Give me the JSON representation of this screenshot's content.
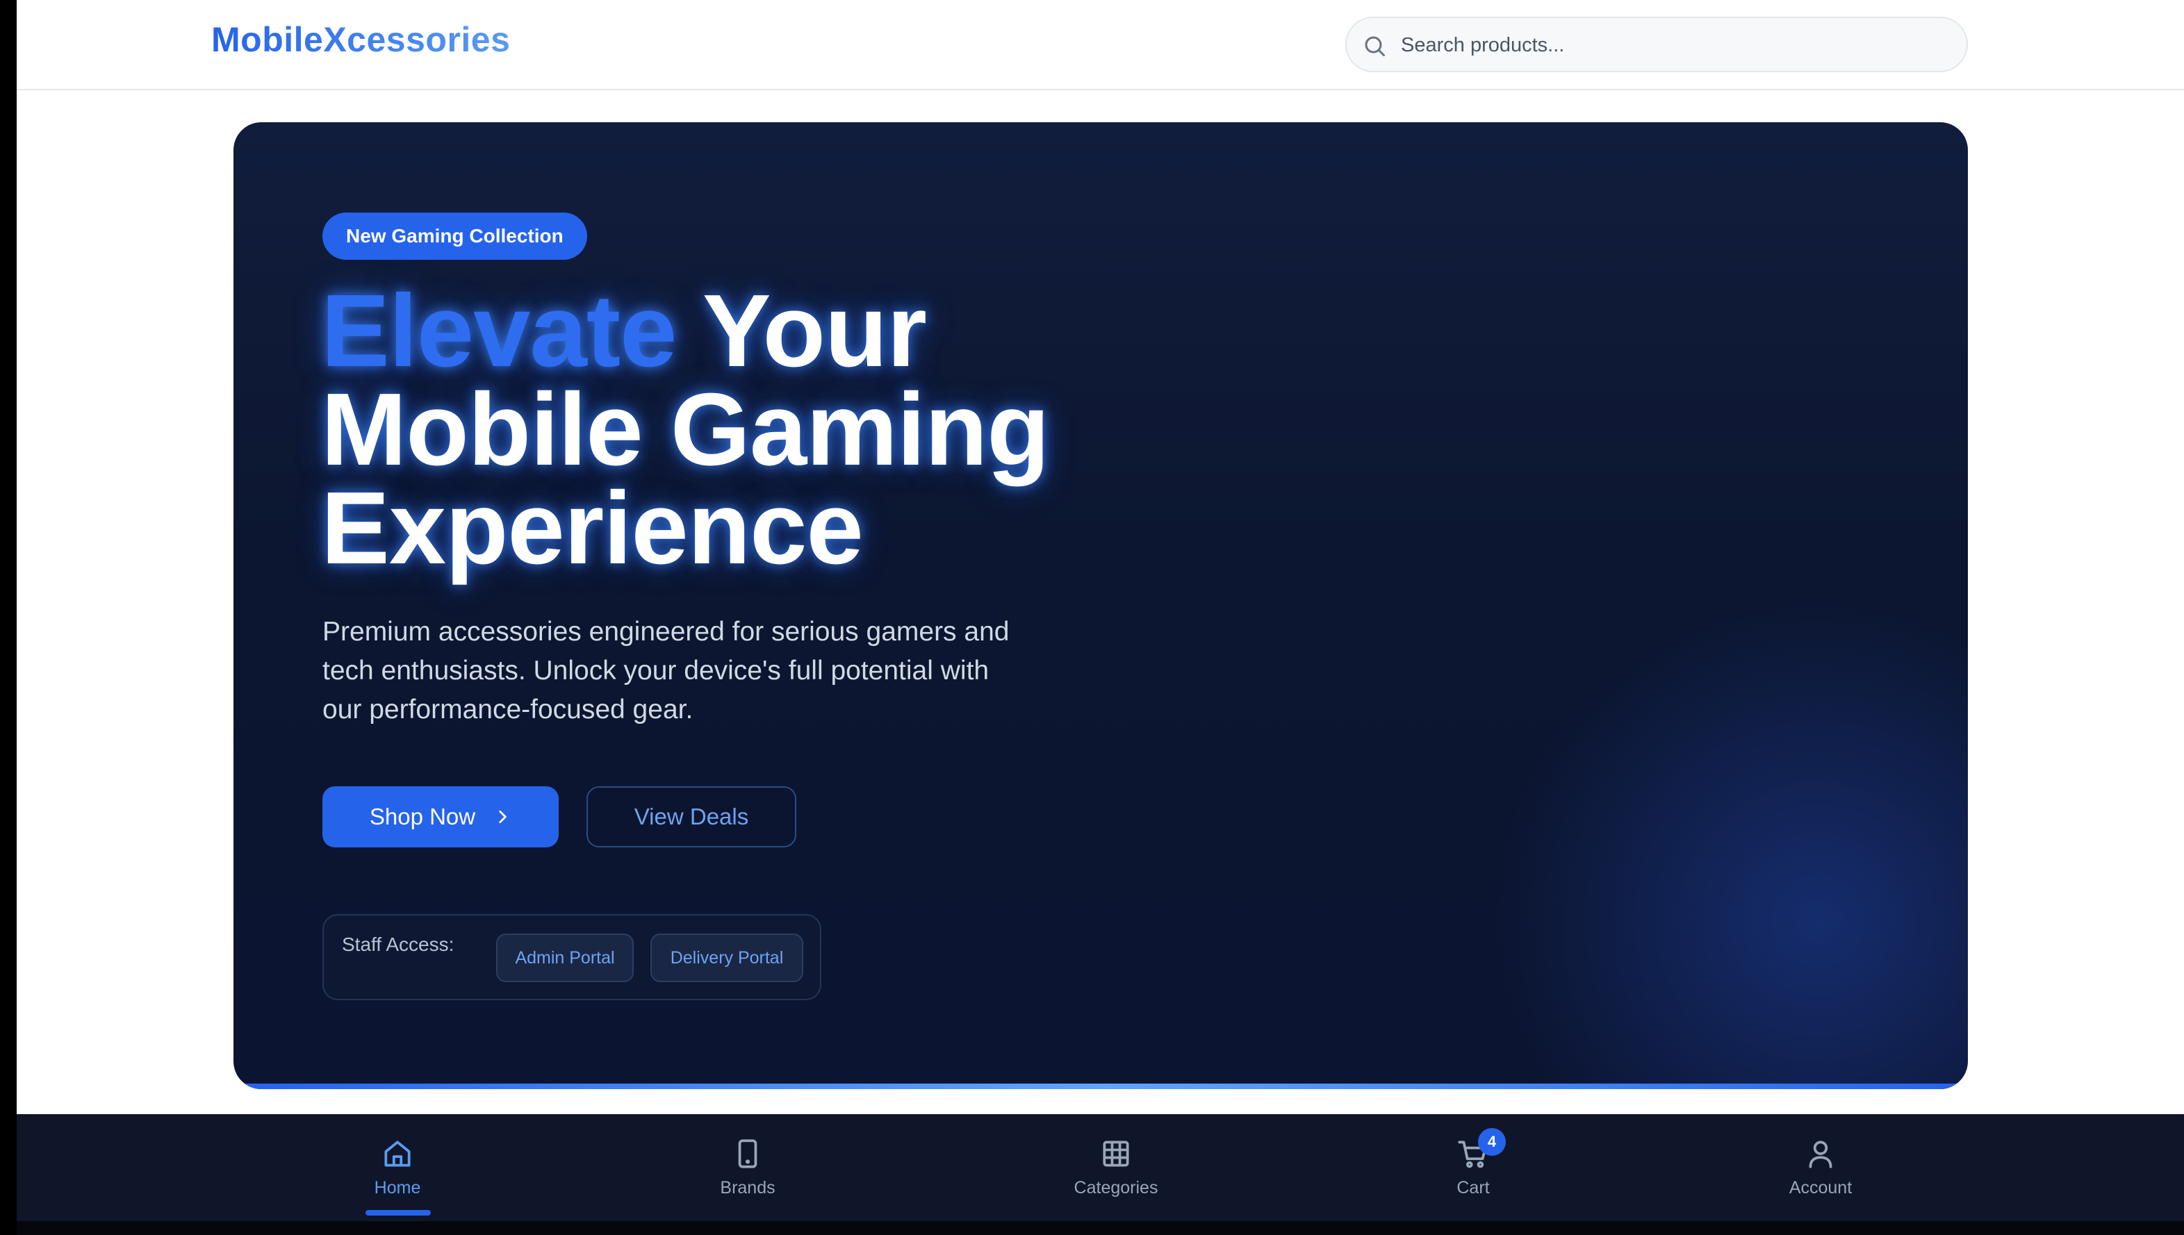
{
  "header": {
    "brand": "MobileXcessories",
    "search_placeholder": "Search products..."
  },
  "hero": {
    "badge": "New Gaming Collection",
    "headline_accent": "Elevate",
    "headline_rest_1": " Your",
    "headline_line_2": "Mobile Gaming",
    "headline_line_3": "Experience",
    "subtitle": "Premium accessories engineered for serious gamers and tech enthusiasts. Unlock your device's full potential with our performance-focused gear.",
    "primary_button": "Shop Now",
    "secondary_button": "View Deals",
    "staff": {
      "label": "Staff Access:",
      "admin_button": "Admin Portal",
      "delivery_button": "Delivery Portal"
    }
  },
  "bottom_nav": {
    "items": [
      {
        "label": "Home",
        "icon": "home-icon",
        "active": true
      },
      {
        "label": "Brands",
        "icon": "phone-icon",
        "active": false
      },
      {
        "label": "Categories",
        "icon": "grid-icon",
        "active": false
      },
      {
        "label": "Cart",
        "icon": "cart-icon",
        "active": false,
        "badge": "4"
      },
      {
        "label": "Account",
        "icon": "user-icon",
        "active": false
      }
    ]
  },
  "colors": {
    "accent": "#2563eb",
    "hero_bg": "#0c1630",
    "nav_bg": "#0f1629"
  }
}
